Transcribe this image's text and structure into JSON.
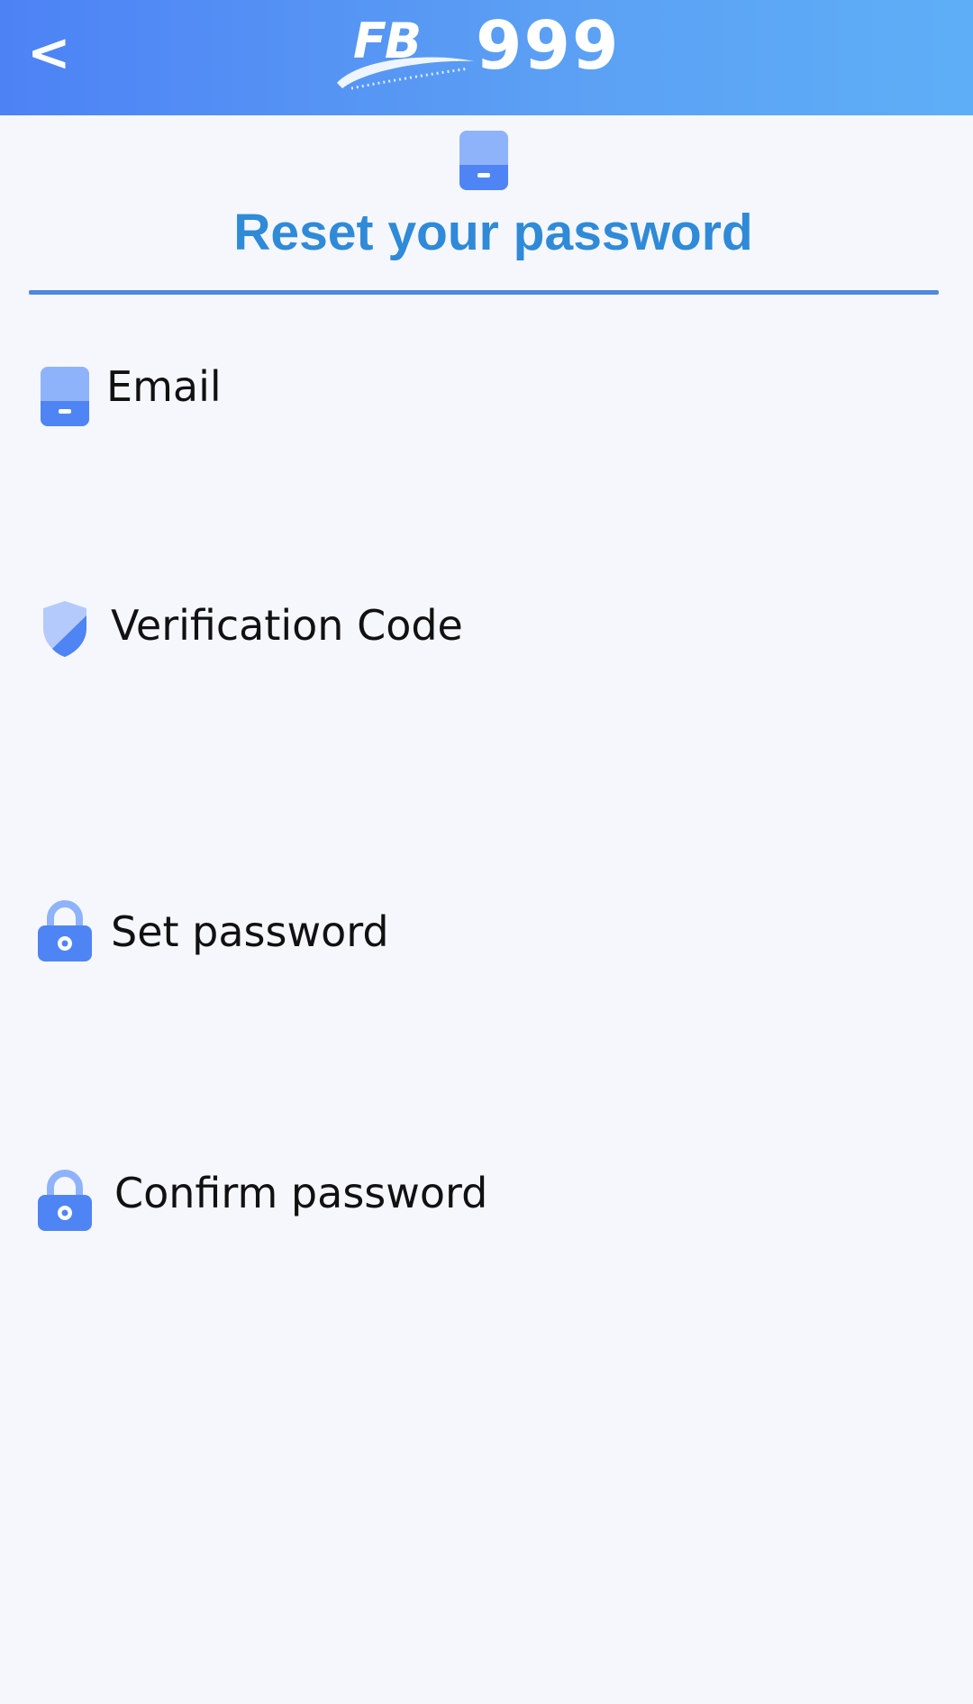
{
  "header": {
    "back_label": "<",
    "logo": {
      "brand_letters": "FB",
      "brand_number": "999"
    }
  },
  "page": {
    "title": "Reset your password",
    "title_icon": "phone-icon"
  },
  "form": {
    "fields": [
      {
        "label": "Email",
        "icon": "phone-icon"
      },
      {
        "label": "Verification Code",
        "icon": "shield-icon"
      },
      {
        "label": "Set password",
        "icon": "lock-icon"
      },
      {
        "label": "Confirm password",
        "icon": "lock-icon"
      }
    ]
  },
  "colors": {
    "header_gradient_start": "#4d82f5",
    "header_gradient_end": "#5eaef7",
    "title": "#2f8ad8",
    "divider": "#4f88dc",
    "icon_light": "#8fb3fb",
    "icon_dark": "#4f84f4",
    "background": "#f5f7fd"
  }
}
